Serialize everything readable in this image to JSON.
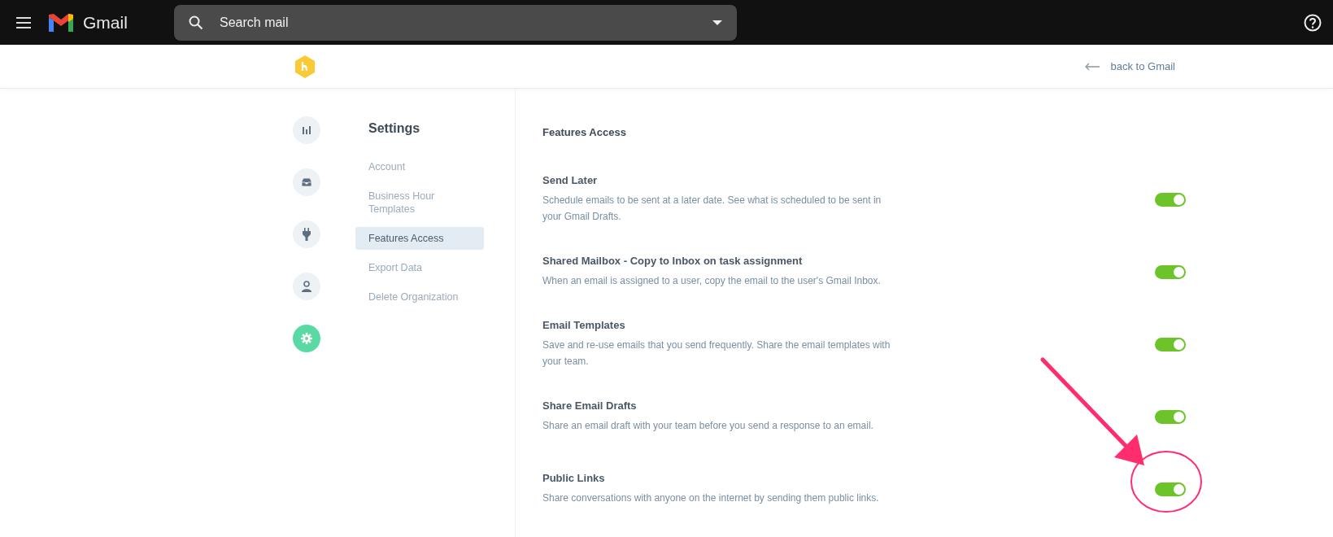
{
  "topbar": {
    "app_name": "Gmail",
    "search": {
      "placeholder": "Search mail"
    }
  },
  "header": {
    "back_link": "back to Gmail"
  },
  "rail": [
    {
      "kind": "bars",
      "selected": false
    },
    {
      "kind": "inbox",
      "selected": false
    },
    {
      "kind": "plug",
      "selected": false
    },
    {
      "kind": "person",
      "selected": false
    },
    {
      "kind": "gear",
      "selected": true
    }
  ],
  "settings_nav": {
    "title": "Settings",
    "items": [
      {
        "label": "Account",
        "selected": false
      },
      {
        "label": "Business Hour Templates",
        "selected": false
      },
      {
        "label": "Features Access",
        "selected": true
      },
      {
        "label": "Export Data",
        "selected": false
      },
      {
        "label": "Delete Organization",
        "selected": false
      }
    ]
  },
  "features": {
    "title": "Features Access",
    "items": [
      {
        "title": "Send Later",
        "description": "Schedule emails to be sent at a later date. See what is scheduled to be sent in your Gmail Drafts.",
        "on": true
      },
      {
        "title": "Shared Mailbox - Copy to Inbox on task assignment",
        "description": "When an email is assigned to a user, copy the email to the user's Gmail Inbox.",
        "on": true
      },
      {
        "title": "Email Templates",
        "description": "Save and re-use emails that you send frequently. Share the email templates with your team.",
        "on": true
      },
      {
        "title": "Share Email Drafts",
        "description": "Share an email draft with your team before you send a response to an email.",
        "on": true
      },
      {
        "title": "Public Links",
        "description": "Share conversations with anyone on the internet by sending them public links.",
        "on": true
      }
    ]
  }
}
